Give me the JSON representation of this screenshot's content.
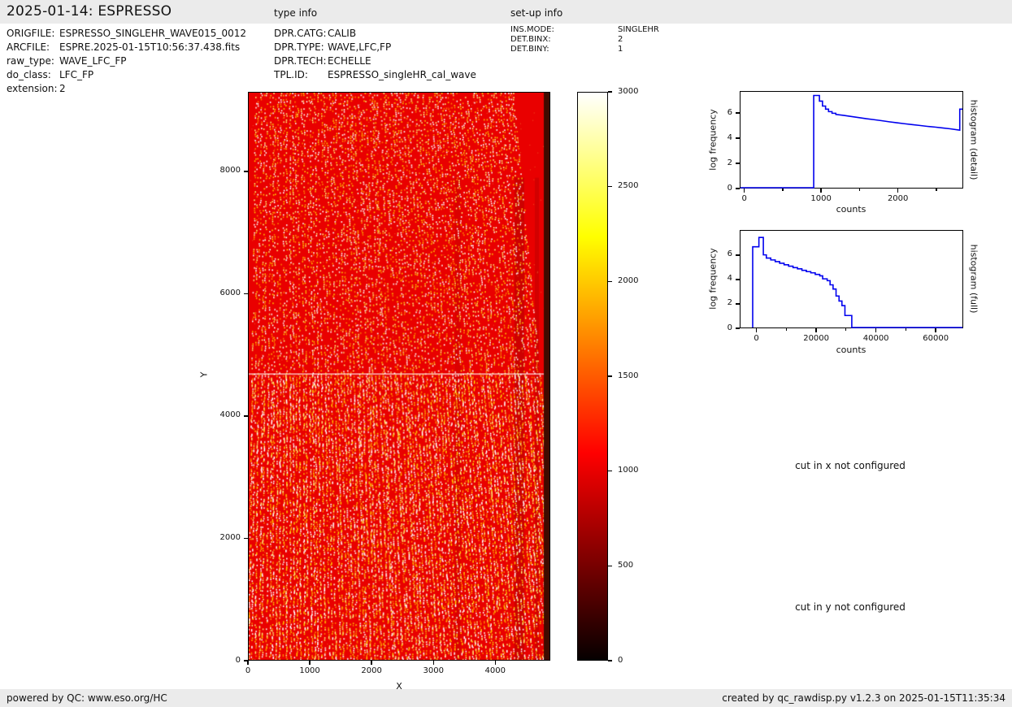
{
  "page": {
    "background": "#ffffff",
    "bar_color": "#ebebeb"
  },
  "header": {
    "title": "2025-01-14: ESPRESSO",
    "type_info_label": "type info",
    "setup_info_label": "set-up info"
  },
  "file_info": {
    "rows": [
      {
        "label": "ORIGFILE:",
        "value": "ESPRESSO_SINGLEHR_WAVE015_0012"
      },
      {
        "label": "ARCFILE:",
        "value": "ESPRE.2025-01-15T10:56:37.438.fits"
      },
      {
        "label": "raw_type:",
        "value": "WAVE_LFC_FP"
      },
      {
        "label": "do_class:",
        "value": "LFC_FP"
      },
      {
        "label": "extension:",
        "value": "2"
      }
    ]
  },
  "type_info": {
    "rows": [
      {
        "label": "DPR.CATG:",
        "value": "CALIB"
      },
      {
        "label": "DPR.TYPE:",
        "value": "WAVE,LFC,FP"
      },
      {
        "label": "DPR.TECH:",
        "value": "ECHELLE"
      },
      {
        "label": "TPL.ID:",
        "value": "ESPRESSO_singleHR_cal_wave"
      }
    ]
  },
  "setup_info": {
    "rows": [
      {
        "label": "INS.MODE:",
        "value": "SINGLEHR"
      },
      {
        "label": "DET.BINX:",
        "value": "2"
      },
      {
        "label": "DET.BINY:",
        "value": "1"
      }
    ]
  },
  "messages": {
    "cut_x": "cut in x not configured",
    "cut_y": "cut in y not configured"
  },
  "footer": {
    "left": "powered by QC: www.eso.org/HC",
    "right": "created by qc_rawdisp.py v1.2.3 on 2025-01-15T11:35:34"
  },
  "chart_data": [
    {
      "id": "detector_image",
      "type": "heatmap",
      "content": "raw echelle detector frame with dotted LFC/FP comb lines on red background, bright horizontal row near mid-height, dark band at right edge",
      "xlabel": "X",
      "ylabel": "Y",
      "xlim": [
        0,
        4890
      ],
      "ylim": [
        0,
        9300
      ],
      "xticks": [
        0,
        1000,
        2000,
        3000,
        4000
      ],
      "yticks": [
        0,
        2000,
        4000,
        6000,
        8000
      ],
      "colorbar": {
        "min": 0,
        "max": 3000,
        "ticks": [
          0,
          500,
          1000,
          1500,
          2000,
          2500,
          3000
        ],
        "colormap": "hot",
        "stops": [
          [
            "0%",
            "#060000"
          ],
          [
            "36.5%",
            "#ff0000"
          ],
          [
            "74.6%",
            "#ffff00"
          ],
          [
            "100%",
            "#ffffff"
          ]
        ]
      },
      "render": {
        "seed": 42,
        "background": "#e90000",
        "orders": 92,
        "dot_colors": [
          "#ffffff",
          "#ffee77",
          "#ffc400",
          "#ff7f00"
        ],
        "horizontal_line_y_frac": 0.495,
        "right_band": {
          "x": 362,
          "width": 7,
          "color": "#400b00"
        },
        "dark_bands": [
          [
            326,
            12,
            0.33
          ],
          [
            351,
            5,
            0.28
          ],
          [
            253,
            7,
            0.18
          ]
        ]
      }
    },
    {
      "id": "histogram_detail",
      "type": "line",
      "side_label": "histogram (detail)",
      "xlabel": "counts",
      "ylabel": "log frequency",
      "line_color": "#0000ee",
      "xlim": [
        -60,
        2850
      ],
      "ylim": [
        0,
        7.75
      ],
      "xticks": [
        0,
        1000,
        2000
      ],
      "xticks_minor": [
        500,
        1500,
        2500
      ],
      "yticks": [
        0,
        2,
        4,
        6
      ],
      "points": [
        [
          -60,
          0
        ],
        [
          900,
          0
        ],
        [
          900,
          7.45
        ],
        [
          975,
          7.45
        ],
        [
          975,
          7.0
        ],
        [
          1015,
          7.0
        ],
        [
          1015,
          6.6
        ],
        [
          1055,
          6.6
        ],
        [
          1055,
          6.35
        ],
        [
          1095,
          6.35
        ],
        [
          1095,
          6.15
        ],
        [
          1140,
          6.15
        ],
        [
          1140,
          6.02
        ],
        [
          1190,
          6.02
        ],
        [
          1190,
          5.92
        ],
        [
          1290,
          5.85
        ],
        [
          1390,
          5.76
        ],
        [
          1490,
          5.67
        ],
        [
          1590,
          5.58
        ],
        [
          1690,
          5.5
        ],
        [
          1790,
          5.42
        ],
        [
          1890,
          5.33
        ],
        [
          1990,
          5.25
        ],
        [
          2090,
          5.17
        ],
        [
          2190,
          5.1
        ],
        [
          2290,
          5.03
        ],
        [
          2390,
          4.96
        ],
        [
          2490,
          4.9
        ],
        [
          2590,
          4.83
        ],
        [
          2690,
          4.76
        ],
        [
          2815,
          4.65
        ],
        [
          2815,
          6.35
        ],
        [
          2850,
          6.35
        ]
      ]
    },
    {
      "id": "histogram_full",
      "type": "line",
      "side_label": "histogram (full)",
      "xlabel": "counts",
      "ylabel": "log frequency",
      "line_color": "#0000ee",
      "xlim": [
        -5600,
        69200
      ],
      "ylim": [
        0,
        8.05
      ],
      "xticks": [
        0,
        20000,
        40000,
        60000
      ],
      "xticks_minor": [
        10000,
        30000,
        50000
      ],
      "yticks": [
        0,
        2,
        4,
        6
      ],
      "points": [
        [
          -1500,
          0
        ],
        [
          -1500,
          6.72
        ],
        [
          600,
          6.72
        ],
        [
          600,
          7.5
        ],
        [
          2100,
          7.5
        ],
        [
          2100,
          6.05
        ],
        [
          3100,
          6.05
        ],
        [
          3100,
          5.78
        ],
        [
          4600,
          5.78
        ],
        [
          4600,
          5.62
        ],
        [
          6100,
          5.62
        ],
        [
          6100,
          5.48
        ],
        [
          7600,
          5.48
        ],
        [
          7600,
          5.35
        ],
        [
          9100,
          5.35
        ],
        [
          9100,
          5.22
        ],
        [
          10600,
          5.22
        ],
        [
          10600,
          5.1
        ],
        [
          12100,
          5.1
        ],
        [
          12100,
          4.98
        ],
        [
          13600,
          4.98
        ],
        [
          13600,
          4.88
        ],
        [
          15100,
          4.88
        ],
        [
          15100,
          4.76
        ],
        [
          16600,
          4.76
        ],
        [
          16600,
          4.65
        ],
        [
          18100,
          4.65
        ],
        [
          18100,
          4.55
        ],
        [
          19600,
          4.55
        ],
        [
          19600,
          4.42
        ],
        [
          21100,
          4.42
        ],
        [
          21100,
          4.3
        ],
        [
          22100,
          4.3
        ],
        [
          22100,
          4.05
        ],
        [
          23600,
          4.05
        ],
        [
          23600,
          3.9
        ],
        [
          24600,
          3.9
        ],
        [
          24600,
          3.55
        ],
        [
          25600,
          3.55
        ],
        [
          25600,
          3.2
        ],
        [
          26600,
          3.2
        ],
        [
          26600,
          2.62
        ],
        [
          27600,
          2.62
        ],
        [
          27600,
          2.2
        ],
        [
          28600,
          2.2
        ],
        [
          28600,
          1.82
        ],
        [
          29600,
          1.82
        ],
        [
          29600,
          1.0
        ],
        [
          31900,
          1.0
        ],
        [
          31900,
          0
        ],
        [
          69200,
          0
        ]
      ]
    }
  ]
}
